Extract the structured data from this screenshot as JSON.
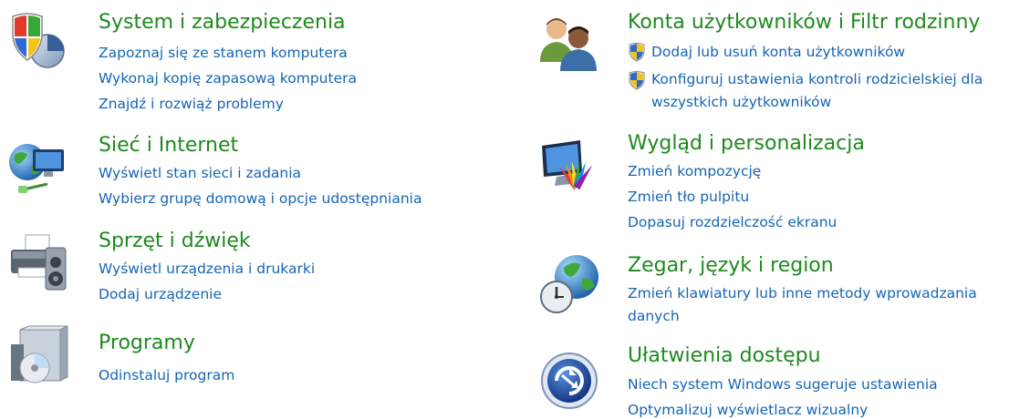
{
  "categories": {
    "system": {
      "title": "System i zabezpieczenia",
      "icon": "system-security-shield-icon",
      "links": [
        "Zapoznaj się ze stanem komputera",
        "Wykonaj kopię zapasową komputera",
        "Znajdź i rozwiąż problemy"
      ]
    },
    "network": {
      "title": "Sieć i Internet",
      "icon": "network-globe-icon",
      "links": [
        "Wyświetl stan sieci i zadania",
        "Wybierz grupę domową i opcje udostępniania"
      ]
    },
    "hardware": {
      "title": "Sprzęt i dźwięk",
      "icon": "printer-speaker-icon",
      "links": [
        "Wyświetl urządzenia i drukarki",
        "Dodaj urządzenie"
      ]
    },
    "programs": {
      "title": "Programy",
      "icon": "programs-box-disc-icon",
      "links": [
        "Odinstaluj program"
      ]
    },
    "accounts": {
      "title": "Konta użytkowników i Filtr rodzinny",
      "icon": "users-icon",
      "links": [
        "Dodaj lub usuń konta użytkowników",
        "Konfiguruj ustawienia kontroli rodzicielskiej dla",
        "wszystkich użytkowników"
      ]
    },
    "appearance": {
      "title": "Wygląd i personalizacja",
      "icon": "monitor-color-palette-icon",
      "links": [
        "Zmień kompozycję",
        "Zmień tło pulpitu",
        "Dopasuj rozdzielczość ekranu"
      ]
    },
    "clock": {
      "title": "Zegar, język i region",
      "icon": "clock-globe-icon",
      "links": [
        "Zmień klawiatury lub inne metody wprowadzania",
        "danych"
      ]
    },
    "access": {
      "title": "Ułatwienia dostępu",
      "icon": "ease-of-access-icon",
      "links": [
        "Niech system Windows sugeruje ustawienia",
        "Optymalizuj wyświetlacz wizualny"
      ]
    }
  }
}
